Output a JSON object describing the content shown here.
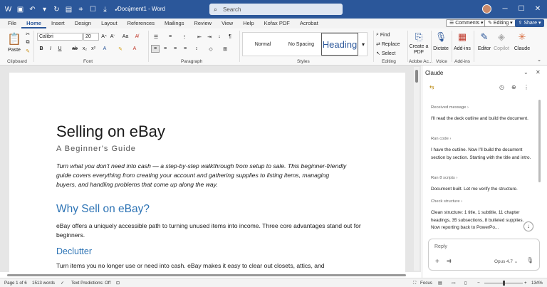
{
  "window": {
    "doc_title": "Document1  -  Word",
    "search_placeholder": "Search"
  },
  "ribbon_tabs": [
    "File",
    "Home",
    "Insert",
    "Design",
    "Layout",
    "References",
    "Mailings",
    "Review",
    "View",
    "Help",
    "Kofax PDF",
    "Acrobat"
  ],
  "tab_right": {
    "comments": "Comments",
    "editing": "Editing",
    "share": "Share"
  },
  "ribbon": {
    "paste": "Paste",
    "font_name": "Calibri",
    "font_size": "20",
    "styles": {
      "normal": "Normal",
      "no_spacing": "No Spacing",
      "heading": "Heading"
    },
    "find": "Find",
    "replace": "Replace",
    "select": "Select",
    "create_pdf": "Create a PDF",
    "dictate": "Dictate",
    "addins": "Add-ins",
    "editor": "Editor",
    "copilot": "Copilot",
    "claude": "Claude",
    "groups": {
      "clipboard": "Clipboard",
      "font": "Font",
      "paragraph": "Paragraph",
      "styles": "Styles",
      "editing": "Editing",
      "adobe": "Adobe Ac...",
      "voice": "Voice",
      "addins": "Add-ins"
    }
  },
  "document": {
    "title": "Selling on eBay",
    "subtitle": "A Beginner's Guide",
    "intro": "Turn what you don't need into cash — a step-by-step walkthrough from setup to sale. This beginner-friendly guide covers everything from creating your account and gathering supplies to listing items, managing buyers, and handling problems that come up along the way.",
    "h1": "Why Sell on eBay?",
    "p1": "eBay offers a uniquely accessible path to turning unused items into income. Three core advantages stand out for beginners.",
    "h2": "Declutter",
    "p2": "Turn items you no longer use or need into cash. eBay makes it easy to clear out closets, attics, and"
  },
  "pane": {
    "title": "Claude",
    "steps": [
      {
        "label": "Received message",
        "text": "I'll read the deck outline and build the document."
      },
      {
        "label": "Ran code",
        "text": "I have the outline. Now I'll build the document section by section. Starting with the title and intro."
      },
      {
        "label": "Ran 8 scripts",
        "text": "Document built. Let me verify the structure."
      },
      {
        "label": "Check structure",
        "text": "Clean structure: 1 title, 1 subtitle, 11 chapter headings, 35 subsections, 8 bulleted supplies. Now reporting back to PowerPo..."
      }
    ],
    "reply_placeholder": "Reply",
    "model": "Opus 4.7"
  },
  "status": {
    "page": "Page 1 of 6",
    "words": "1513 words",
    "predictions": "Text Predictions: Off",
    "focus": "Focus",
    "zoom": "134%"
  },
  "colors": {
    "brand": "#2b579a",
    "heading": "#2e74b5"
  }
}
